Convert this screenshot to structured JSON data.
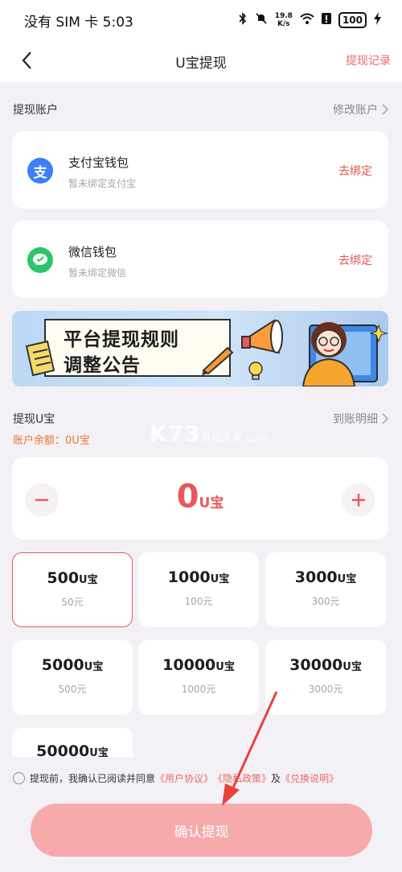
{
  "status_bar": {
    "carrier": "没有 SIM 卡 5:03",
    "speed_value": "19.8",
    "speed_unit": "K/s",
    "battery": "100"
  },
  "nav": {
    "title": "U宝提现",
    "records_label": "提现记录"
  },
  "accounts_section": {
    "title": "提现账户",
    "edit_label": "修改账户"
  },
  "accounts": [
    {
      "name": "支付宝钱包",
      "status": "暂未绑定支付宝",
      "bind_label": "去绑定",
      "icon_glyph": "支",
      "color": "#3d7ff4"
    },
    {
      "name": "微信钱包",
      "status": "暂未绑定微信",
      "bind_label": "去绑定",
      "color": "#2bc56b"
    }
  ],
  "banner": {
    "line1": "平台提现规则",
    "line2": "调整公告"
  },
  "withdraw_section": {
    "title": "提现U宝",
    "detail_label": "到账明细",
    "balance": "账户余额：0U宝"
  },
  "stepper": {
    "amount": "0",
    "unit": "U宝"
  },
  "options": [
    {
      "amount": "500",
      "unit": "U宝",
      "price": "50元",
      "selected": true
    },
    {
      "amount": "1000",
      "unit": "U宝",
      "price": "100元",
      "selected": false
    },
    {
      "amount": "3000",
      "unit": "U宝",
      "price": "300元",
      "selected": false
    },
    {
      "amount": "5000",
      "unit": "U宝",
      "price": "500元",
      "selected": false
    },
    {
      "amount": "10000",
      "unit": "U宝",
      "price": "1000元",
      "selected": false
    },
    {
      "amount": "30000",
      "unit": "U宝",
      "price": "3000元",
      "selected": false
    },
    {
      "amount": "50000",
      "unit": "U宝",
      "price": "",
      "selected": false
    }
  ],
  "agreement": {
    "prefix": "提现前，我确认已阅读并同意",
    "user_agreement": "《用户协议》",
    "privacy_policy": "《隐私政策》",
    "and": "及",
    "exchange_notes": "《兑换说明》"
  },
  "confirm_label": "确认提现",
  "watermark": {
    "main": "K73",
    "sub1": "游戏之家",
    "sub2": ".com"
  },
  "colors": {
    "accent": "#e9575a",
    "link": "#e86b6b",
    "balance": "#e8772e",
    "confirm_bg": "#f6aaab",
    "page_bg": "#f3f1f6"
  }
}
